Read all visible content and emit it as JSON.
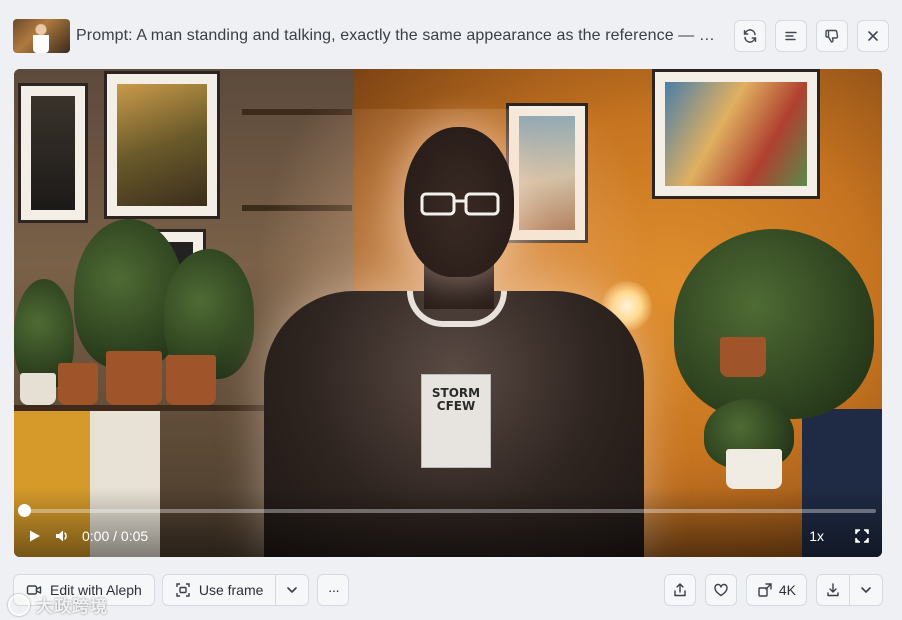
{
  "header": {
    "prompt": "Prompt: A man standing and talking, exactly the same appearance as the reference — sa...",
    "buttons": {
      "regenerate": "refresh-icon",
      "details": "lines-icon",
      "dislike": "thumbs-down-icon",
      "close": "close-icon"
    }
  },
  "video": {
    "shirt_text": "STORM\nCFEW",
    "time": "0:00 / 0:05",
    "rate": "1x",
    "progress": 0.0
  },
  "toolbar": {
    "edit_label": "Edit with Aleph",
    "use_frame_label": "Use frame",
    "more_label": "···",
    "upscale_label": "4K"
  },
  "watermark": {
    "text": "大政跨境"
  },
  "colors": {
    "background": "#eef0f4",
    "accent_orange": "#c67420"
  }
}
